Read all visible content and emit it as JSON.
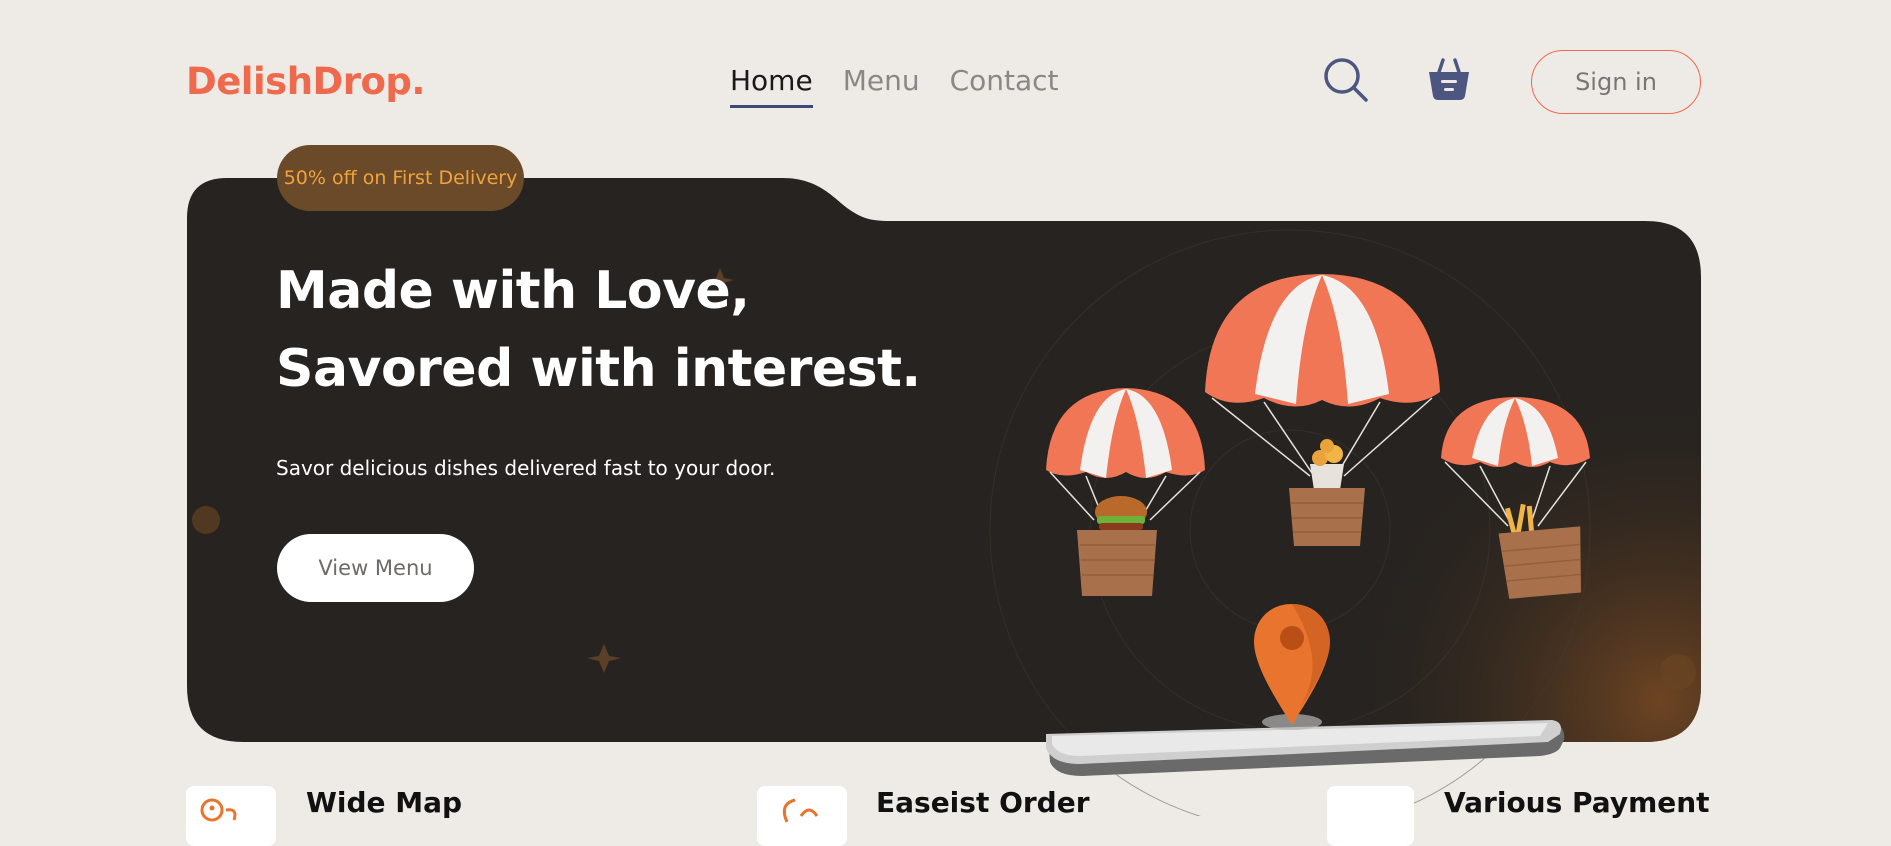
{
  "brand": {
    "name": "DelishDrop."
  },
  "nav": {
    "items": [
      {
        "label": "Home",
        "active": true
      },
      {
        "label": "Menu",
        "active": false
      },
      {
        "label": "Contact",
        "active": false
      }
    ]
  },
  "header": {
    "signin_label": "Sign in",
    "search_icon": "search-icon",
    "cart_icon": "basket-icon"
  },
  "hero": {
    "promo": "50% off on First Delivery",
    "headline_line1": "Made with Love,",
    "headline_line2": "Savored with interest.",
    "subtext": "Savor delicious dishes delivered fast to your door.",
    "cta_label": "View Menu"
  },
  "features": [
    {
      "title": "Wide Map",
      "icon": "map-icon"
    },
    {
      "title": "Easeist Order",
      "icon": "order-icon"
    },
    {
      "title": "Various Payment",
      "icon": "payment-icon"
    }
  ],
  "colors": {
    "brand": "#ef6a4c",
    "background": "#eeebe7",
    "hero_dark": "#272320",
    "nav_underline": "#3d4a75",
    "promo_text": "#f0a33d"
  }
}
